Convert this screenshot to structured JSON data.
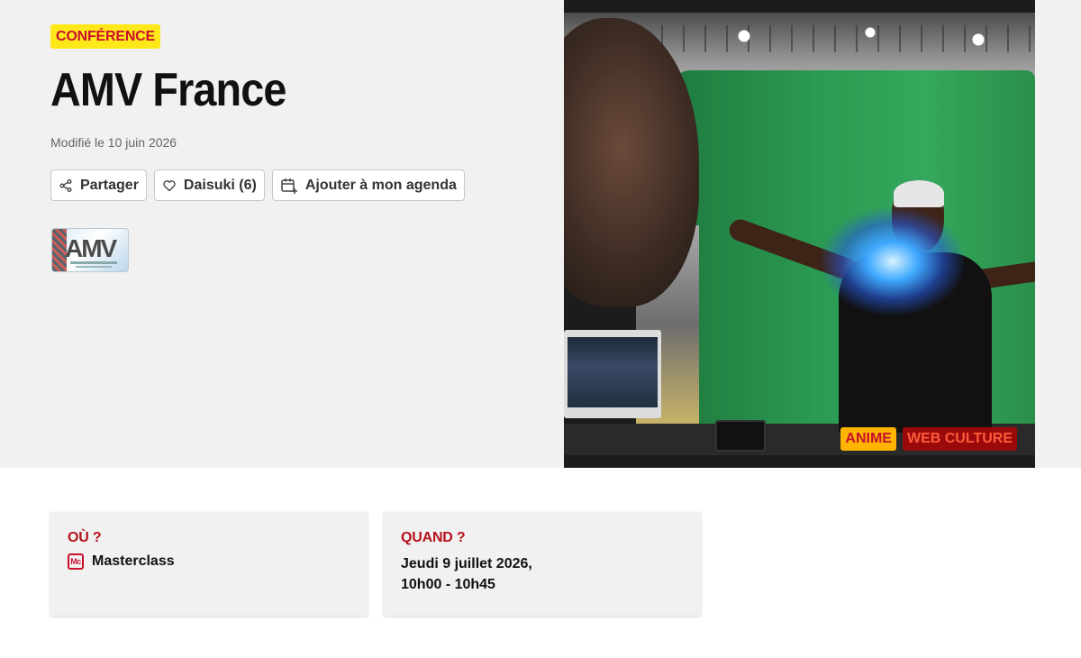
{
  "event": {
    "category": "CONFÉRENCE",
    "title": "AMV France",
    "modified": "Modifié le 10 juin 2026"
  },
  "actions": {
    "share_label": "Partager",
    "daisuki_label": "Daisuki (6)",
    "agenda_label": "Ajouter à mon agenda"
  },
  "thumbnail": {
    "text": "AMV"
  },
  "photo_tags": [
    "ANIME",
    "WEB CULTURE"
  ],
  "where": {
    "label": "OÙ ?",
    "icon_text": "Mc",
    "value": "Masterclass"
  },
  "when": {
    "label": "QUAND ?",
    "line1": "Jeudi 9 juillet 2026,",
    "line2": "10h00 - 10h45"
  },
  "colors": {
    "accent_red": "#b5121b",
    "badge_yellow": "#ffe81a",
    "hero_bg": "#f1f1f1"
  },
  "icons": [
    "share-icon",
    "heart-icon",
    "calendar-add-icon",
    "masterclass-icon"
  ]
}
